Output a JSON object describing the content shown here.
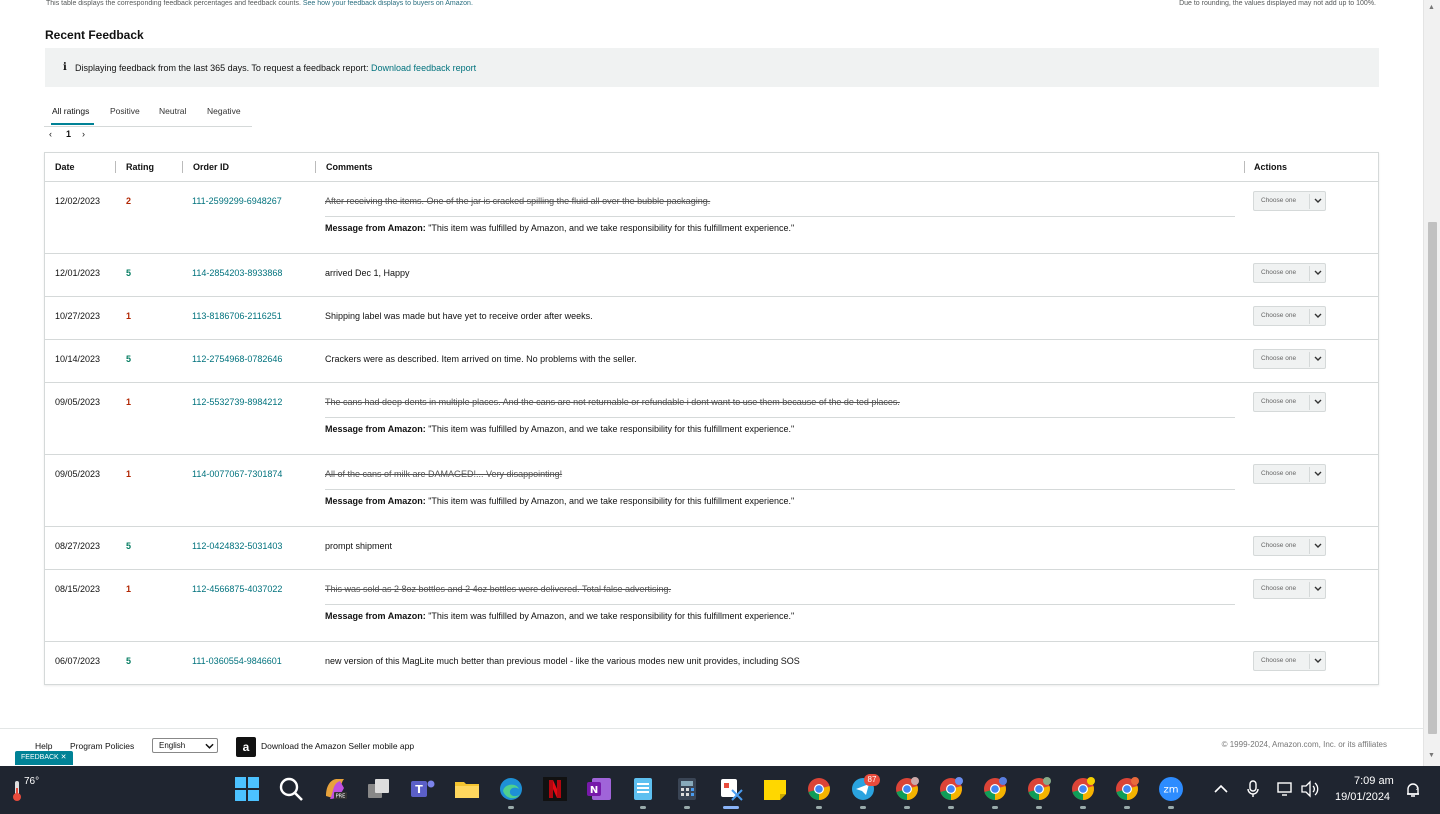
{
  "top": {
    "note_text": "This table displays the corresponding feedback percentages and feedback counts.",
    "note_link": "See how your feedback displays to buyers on Amazon.",
    "rounding_note": "Due to rounding, the values displayed may not add up to 100%."
  },
  "section_title": "Recent Feedback",
  "info": {
    "text": "Displaying feedback from the last 365 days. To request a feedback report:",
    "link": "Download feedback report"
  },
  "tabs": [
    "All ratings",
    "Positive",
    "Neutral",
    "Negative"
  ],
  "pager": {
    "prev": "‹",
    "page": "1",
    "next": "›"
  },
  "table": {
    "headers": {
      "date": "Date",
      "rating": "Rating",
      "order": "Order ID",
      "comments": "Comments",
      "actions": "Actions"
    },
    "action_label": "Choose one",
    "message_label": "Message from Amazon:",
    "message_text": "\"This item was fulfilled by Amazon, and we take responsibility for this fulfillment experience.\"",
    "rows": [
      {
        "date": "12/02/2023",
        "rating": "2",
        "order": "111-2599299-6948267",
        "comment": "After receiving the items. One of the jar is cracked spilling the fluid all over the bubble packaging.",
        "struck": true
      },
      {
        "date": "12/01/2023",
        "rating": "5",
        "order": "114-2854203-8933868",
        "comment": "arrived Dec 1, Happy",
        "struck": false
      },
      {
        "date": "10/27/2023",
        "rating": "1",
        "order": "113-8186706-2116251",
        "comment": "Shipping label was made but have yet to receive order after weeks.",
        "struck": false
      },
      {
        "date": "10/14/2023",
        "rating": "5",
        "order": "112-2754968-0782646",
        "comment": "Crackers were as described. Item arrived on time. No problems with the seller.",
        "struck": false
      },
      {
        "date": "09/05/2023",
        "rating": "1",
        "order": "112-5532739-8984212",
        "comment": "The cans had deep dents in multiple places. And the cans are not returnable or refundable i dont want to use them because of the de ted places.",
        "struck": true
      },
      {
        "date": "09/05/2023",
        "rating": "1",
        "order": "114-0077067-7301874",
        "comment": "All of the cans of milk are DAMAGED!... Very disappointing!",
        "struck": true
      },
      {
        "date": "08/27/2023",
        "rating": "5",
        "order": "112-0424832-5031403",
        "comment": "prompt shipment",
        "struck": false
      },
      {
        "date": "08/15/2023",
        "rating": "1",
        "order": "112-4566875-4037022",
        "comment": "This was sold as 2 8oz bottles and 2 4oz bottles were delivered. Total false advertising.",
        "struck": true
      },
      {
        "date": "06/07/2023",
        "rating": "5",
        "order": "111-0360554-9846601",
        "comment": "new version of this MagLite much better than previous model - like the various modes new unit provides, including SOS",
        "struck": false
      }
    ]
  },
  "footer": {
    "help": "Help",
    "policies": "Program Policies",
    "language": "English",
    "app_icon_letter": "a",
    "app_text": "Download the Amazon Seller mobile app",
    "copyright": "© 1999-2024, Amazon.com, Inc. or its affiliates",
    "feedback_tab": "FEEDBACK ✕"
  },
  "taskbar": {
    "temperature": "76°",
    "telegram_badge": "87",
    "time": "7:09 am",
    "date": "19/01/2024"
  },
  "colors": {
    "accent": "#008296",
    "link": "#00727d",
    "rating_bad": "#b12704",
    "rating_good": "#067d62",
    "taskbar": "#1f2530"
  }
}
